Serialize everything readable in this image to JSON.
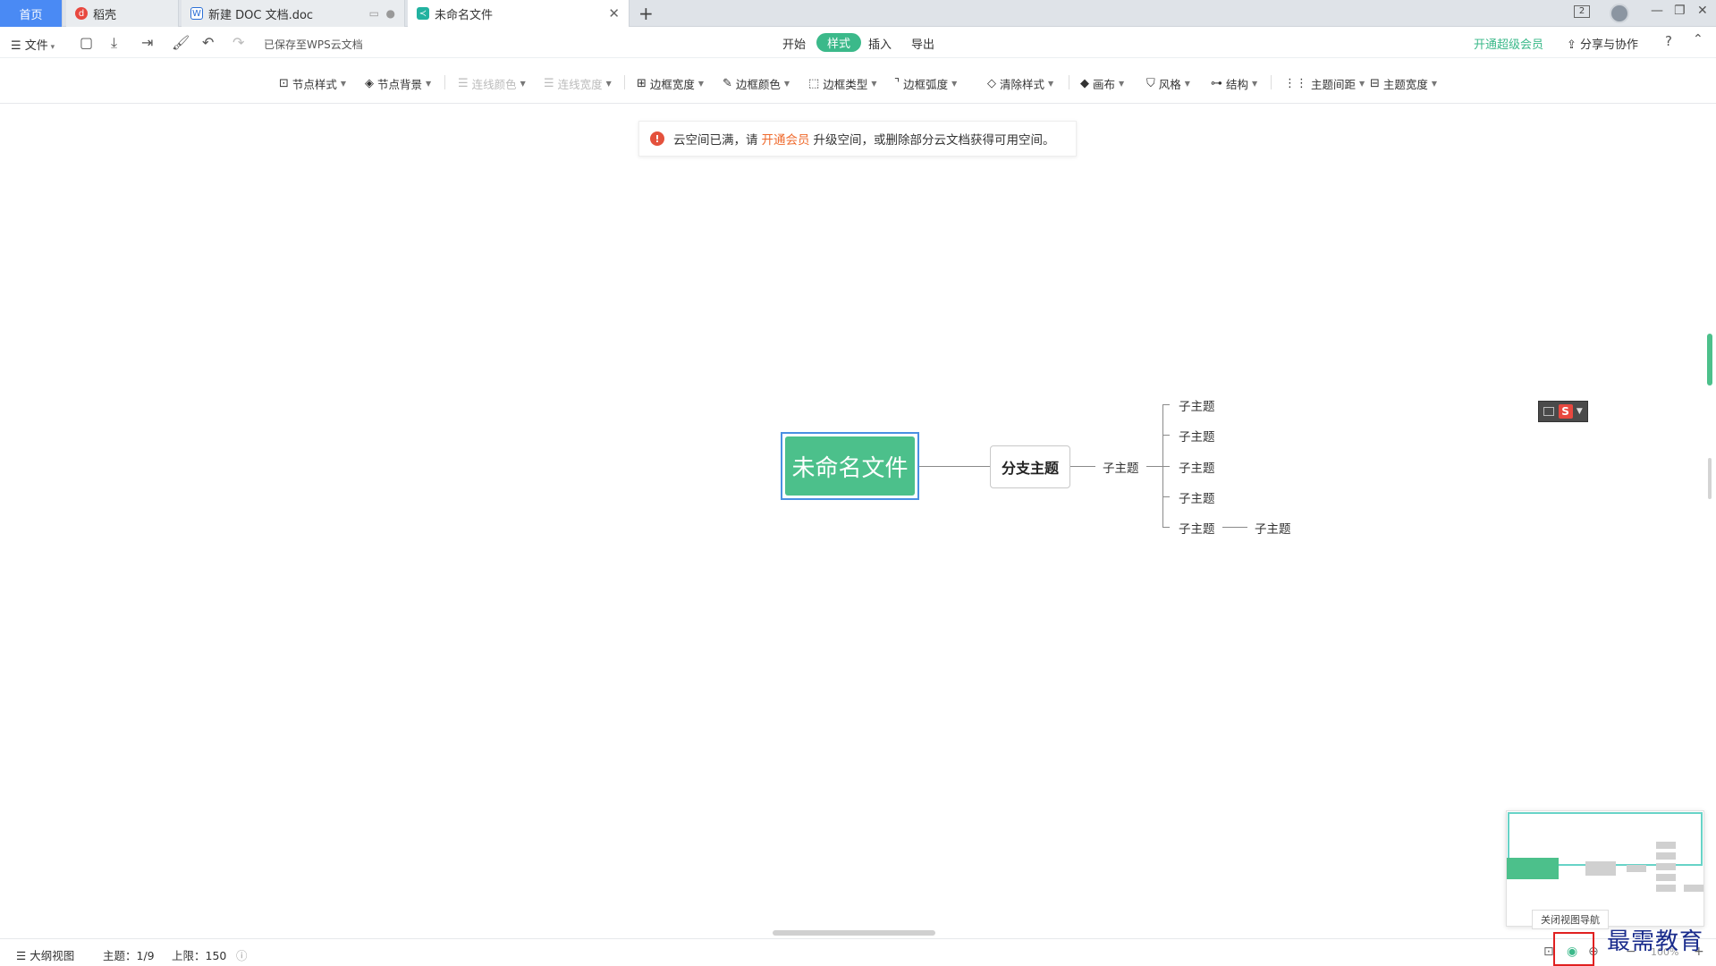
{
  "tabs": {
    "home": "首页",
    "t1": "稻壳",
    "t2": "新建 DOC 文档.doc",
    "t3": "未命名文件",
    "new_tab": "+",
    "badge": "2"
  },
  "menu": {
    "file": "文件",
    "saved_status": "已保存至WPS云文档",
    "nav": [
      "开始",
      "样式",
      "插入",
      "导出"
    ],
    "vip": "开通超级会员",
    "share": "分享与协作",
    "help": "?"
  },
  "ribbon": {
    "items": [
      "节点样式",
      "节点背景",
      "连线颜色",
      "连线宽度",
      "边框宽度",
      "边框颜色",
      "边框类型",
      "边框弧度",
      "清除样式",
      "画布",
      "风格",
      "结构",
      "主题间距",
      "主题宽度"
    ]
  },
  "notice": {
    "prefix": "云空间已满，请",
    "link": "开通会员",
    "suffix": "升级空间，或删除部分云文档获得可用空间。"
  },
  "mindmap": {
    "root": "未命名文件",
    "branch": "分支主题",
    "sub_level1": "子主题",
    "sub_level2": [
      "子主题",
      "子主题",
      "子主题",
      "子主题",
      "子主题"
    ],
    "sub_level3": "子主题"
  },
  "minimap": {
    "tooltip": "关闭视图导航",
    "colors": {
      "root": "#4cc08b",
      "node": "#d0d0d0",
      "viewport": "#67d3c7"
    }
  },
  "status": {
    "outline": "大纲视图",
    "topics": "主题：1/9",
    "limit": "上限：150",
    "zoom": "100%"
  },
  "watermark": "最需教育",
  "colors": {
    "accent": "#3bb98a",
    "home_tab": "#4a8af4",
    "notice_link": "#ef6a2c",
    "highlight": "#e02020"
  }
}
